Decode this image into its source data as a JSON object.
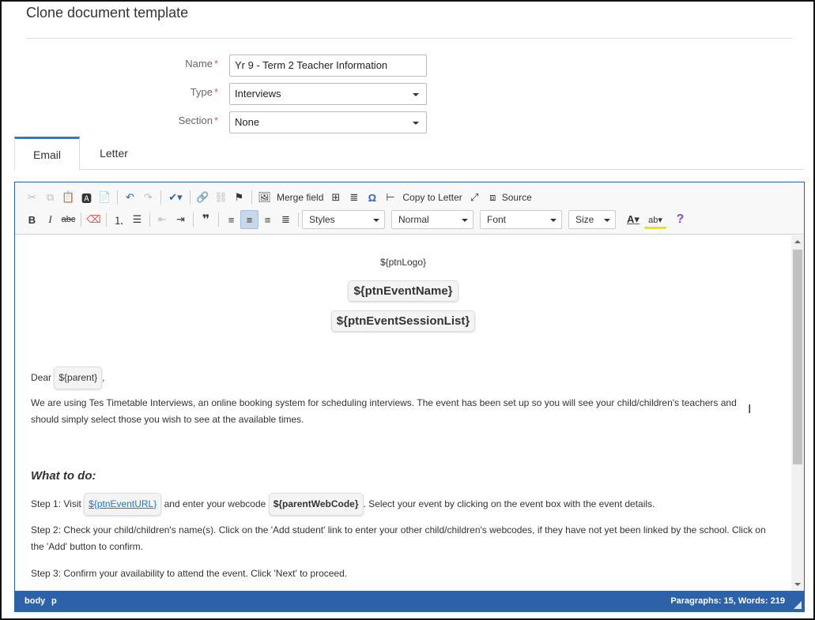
{
  "page": {
    "title": "Clone document template"
  },
  "form": {
    "name": {
      "label": "Name",
      "value": "Yr 9 - Term 2 Teacher Information"
    },
    "type": {
      "label": "Type",
      "value": "Interviews"
    },
    "section": {
      "label": "Section",
      "value": "None"
    },
    "required_mark": "*"
  },
  "tabs": {
    "email": "Email",
    "letter": "Letter"
  },
  "toolbar": {
    "merge_field": "Merge field",
    "copy_to_letter": "Copy to Letter",
    "source": "Source",
    "styles": "Styles",
    "format": "Normal",
    "font": "Font",
    "size": "Size",
    "help": "?",
    "bold": "B",
    "italic": "I",
    "strike": "abc"
  },
  "content": {
    "logo": "${ptnLogo}",
    "event_name": "${ptnEventName}",
    "session_list": "${ptnEventSessionList}",
    "dear": "Dear",
    "parent": "${parent}",
    "comma": ",",
    "intro": "We are using Tes Timetable Interviews, an online booking system for scheduling interviews.  The event has been set up so you will see your child/children's teachers and should simply select those you wish to see at the available times.",
    "what_to_do": "What to do:",
    "step1_pre": "Step 1:  Visit",
    "step1_url": "${ptnEventURL}",
    "step1_mid": "and enter your webcode",
    "step1_code": "${parentWebCode}",
    "step1_post": ".  Select your event by clicking on the event box with the event details.",
    "step2": "Step 2:  Check your child/children's name(s).  Click on the 'Add student' link to enter your other child/children's webcodes, if they have not yet been linked by the school.  Click on the 'Add' button to confirm.",
    "step3": "Step 3:  Confirm your availability to attend the event.  Click 'Next' to proceed."
  },
  "statusbar": {
    "path_body": "body",
    "path_p": "p",
    "counts": "Paragraphs: 15, Words: 219"
  },
  "colors": {
    "accent": "#2b7bd6",
    "statusbar": "#2e62a8",
    "required": "#d9534f",
    "link": "#2277cc"
  }
}
